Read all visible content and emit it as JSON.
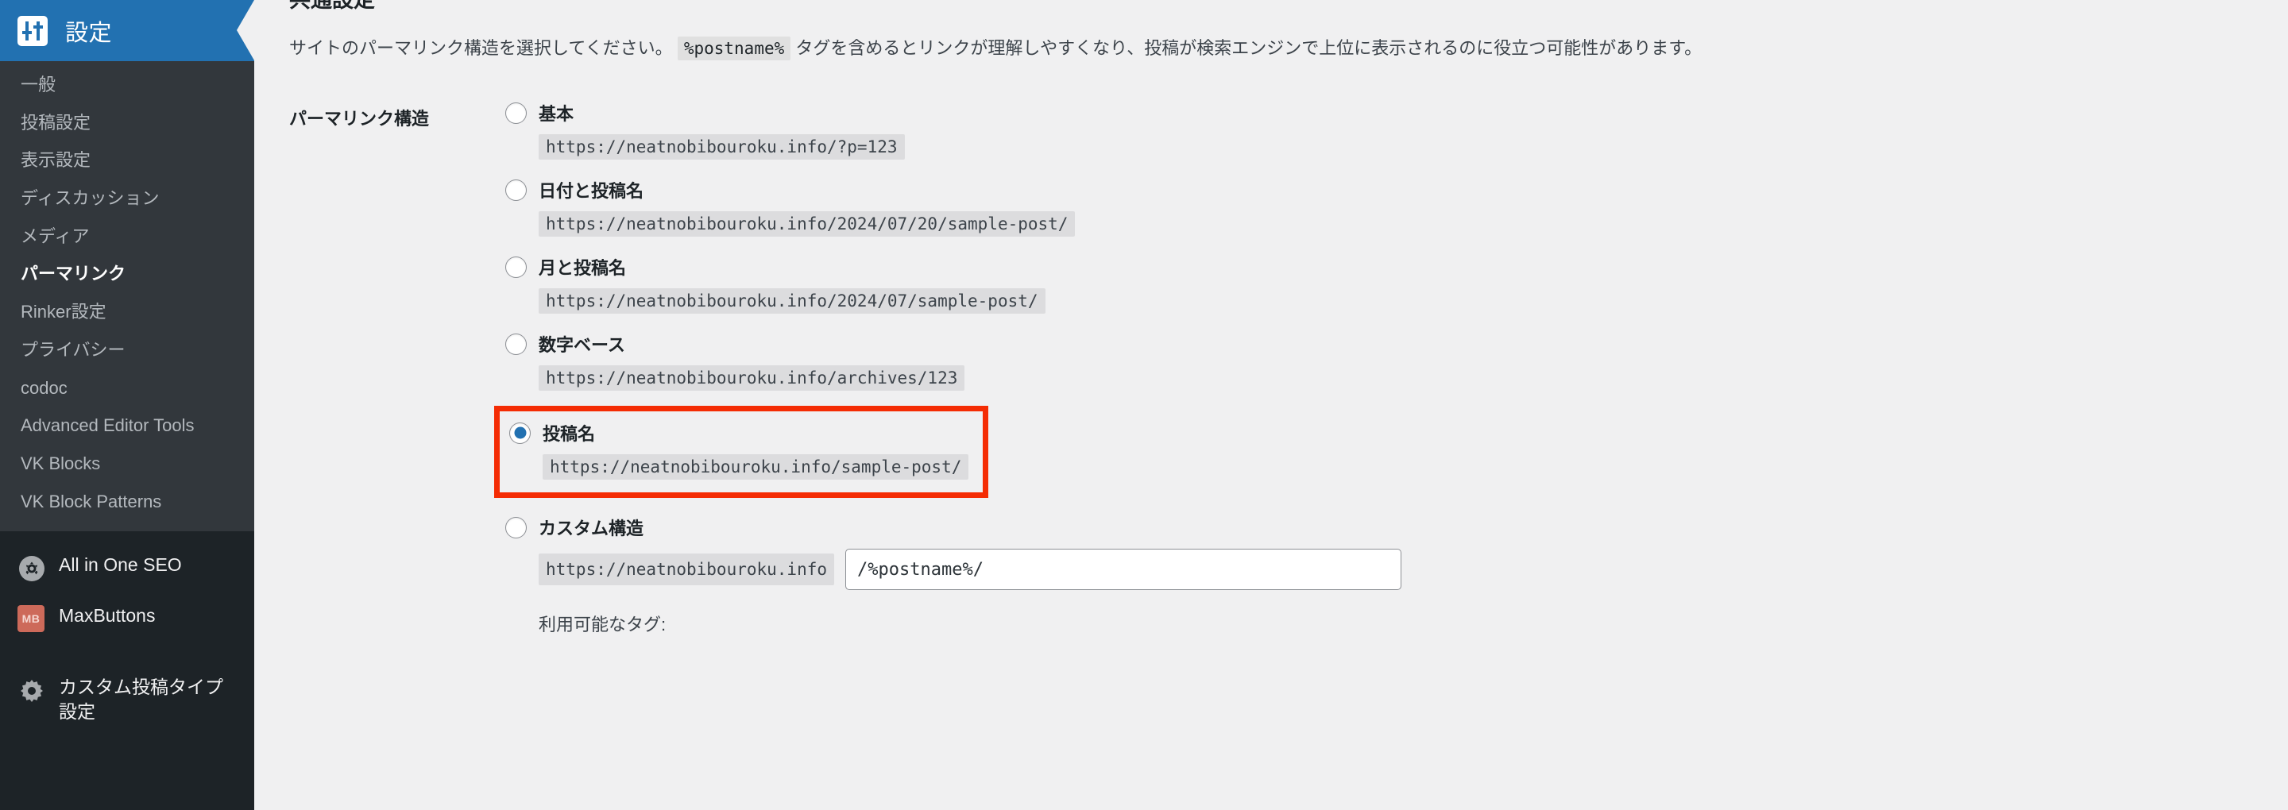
{
  "sidebar": {
    "header": {
      "title": "設定",
      "icon": "settings-sliders-icon"
    },
    "submenu": [
      {
        "label": "一般",
        "active": false
      },
      {
        "label": "投稿設定",
        "active": false
      },
      {
        "label": "表示設定",
        "active": false
      },
      {
        "label": "ディスカッション",
        "active": false
      },
      {
        "label": "メディア",
        "active": false
      },
      {
        "label": "パーマリンク",
        "active": true
      },
      {
        "label": "Rinker設定",
        "active": false
      },
      {
        "label": "プライバシー",
        "active": false
      },
      {
        "label": "codoc",
        "active": false
      },
      {
        "label": "Advanced Editor Tools",
        "active": false
      },
      {
        "label": "VK Blocks",
        "active": false
      },
      {
        "label": "VK Block Patterns",
        "active": false
      }
    ],
    "bottom_menu": [
      {
        "label": "All in One SEO",
        "icon": "gear-circle-icon"
      },
      {
        "label": "MaxButtons",
        "icon": "maxbuttons-badge-icon",
        "badge_text": "MB"
      },
      {
        "label": "カスタム投稿タイプ設定",
        "icon": "gear-icon"
      }
    ]
  },
  "main": {
    "section_title": "共通設定",
    "description_before": "サイトのパーマリンク構造を選択してください。",
    "description_code": "%postname%",
    "description_after": "タグを含めるとリンクが理解しやすくなり、投稿が検索エンジンで上位に表示されるのに役立つ可能性があります。",
    "form_label": "パーマリンク構造",
    "options": [
      {
        "name": "基本",
        "url": "https://neatnobibouroku.info/?p=123",
        "selected": false,
        "highlighted": false
      },
      {
        "name": "日付と投稿名",
        "url": "https://neatnobibouroku.info/2024/07/20/sample-post/",
        "selected": false,
        "highlighted": false
      },
      {
        "name": "月と投稿名",
        "url": "https://neatnobibouroku.info/2024/07/sample-post/",
        "selected": false,
        "highlighted": false
      },
      {
        "name": "数字ベース",
        "url": "https://neatnobibouroku.info/archives/123",
        "selected": false,
        "highlighted": false
      },
      {
        "name": "投稿名",
        "url": "https://neatnobibouroku.info/sample-post/",
        "selected": true,
        "highlighted": true
      }
    ],
    "custom_option": {
      "name": "カスタム構造",
      "selected": false,
      "prefix": "https://neatnobibouroku.info",
      "input_value": "/%postname%/",
      "input_placeholder": ""
    },
    "available_tags_label": "利用可能なタグ:"
  },
  "colors": {
    "sidebar_bg": "#1d2327",
    "submenu_bg": "#32373c",
    "header_blue": "#2271b1",
    "page_bg": "#f0f0f1",
    "highlight_red": "#f42c04",
    "code_bg": "#dcdcde",
    "radio_accent": "#2271b1"
  }
}
